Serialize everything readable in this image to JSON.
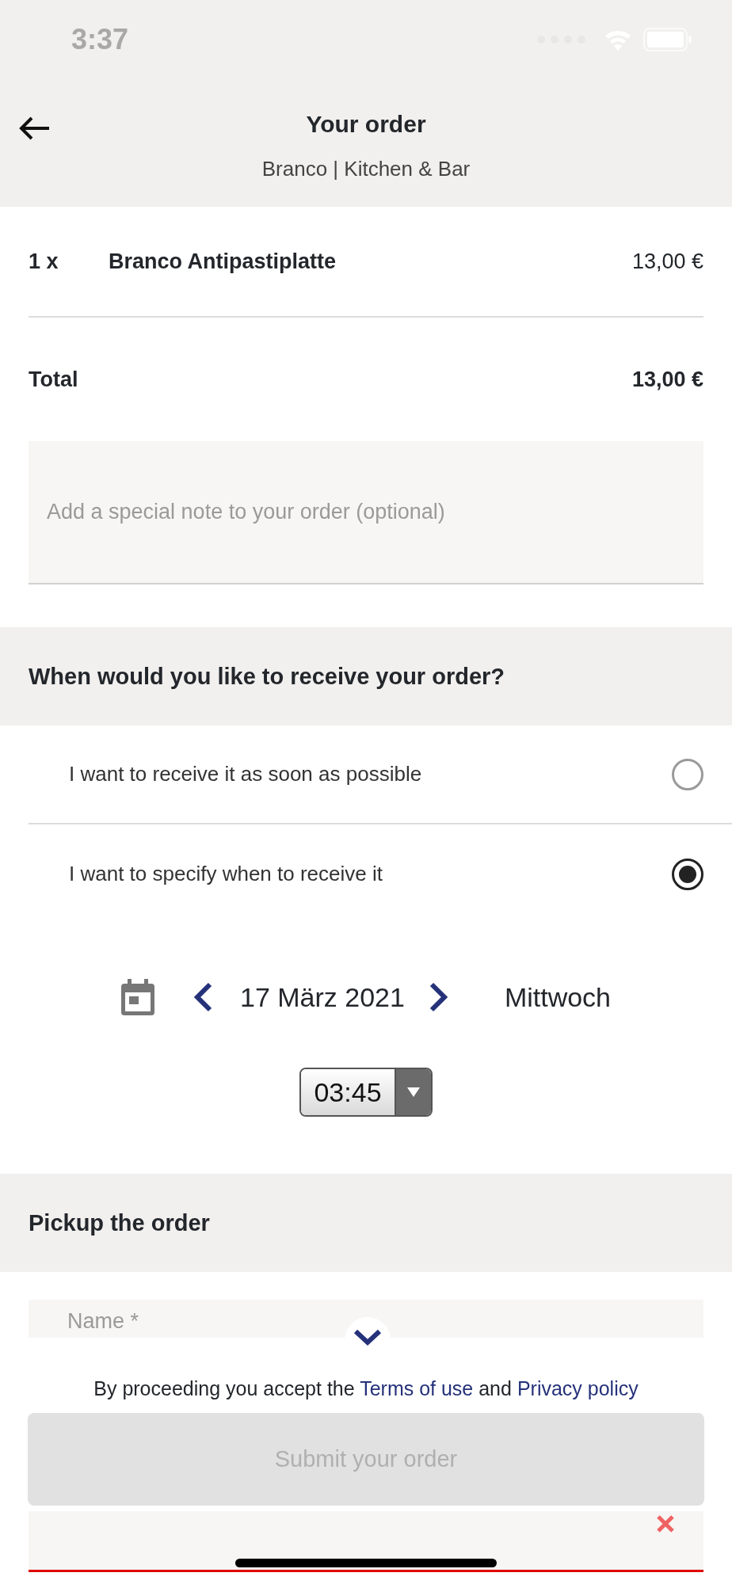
{
  "status_bar": {
    "time": "3:37"
  },
  "header": {
    "title": "Your order",
    "subtitle": "Branco | Kitchen & Bar"
  },
  "items": [
    {
      "quantity": "1 x",
      "name": "Branco Antipastiplatte",
      "price": "13,00 €"
    }
  ],
  "total": {
    "label": "Total",
    "amount": "13,00 €"
  },
  "note_field": {
    "placeholder": "Add a special note to your order (optional)"
  },
  "timing": {
    "heading": "When would you like to receive your order?",
    "options": [
      {
        "label": "I want to receive it as soon as possible",
        "selected": false
      },
      {
        "label": "I want to specify when to receive it",
        "selected": true
      }
    ],
    "date": "17 März 2021",
    "weekday": "Mittwoch",
    "time": "03:45"
  },
  "pickup": {
    "heading": "Pickup the order",
    "name_field": {
      "placeholder": "Name *"
    },
    "email_field": {
      "invalid": true
    }
  },
  "footer": {
    "terms": [
      {
        "kind": "plain",
        "text": "By proceeding you accept the"
      },
      {
        "kind": "link",
        "text": "Terms of use"
      },
      {
        "kind": "plain",
        "text": "and"
      },
      {
        "kind": "link",
        "text": "Privacy policy"
      }
    ],
    "submit": {
      "label": "Submit your order",
      "disabled": true
    }
  }
}
